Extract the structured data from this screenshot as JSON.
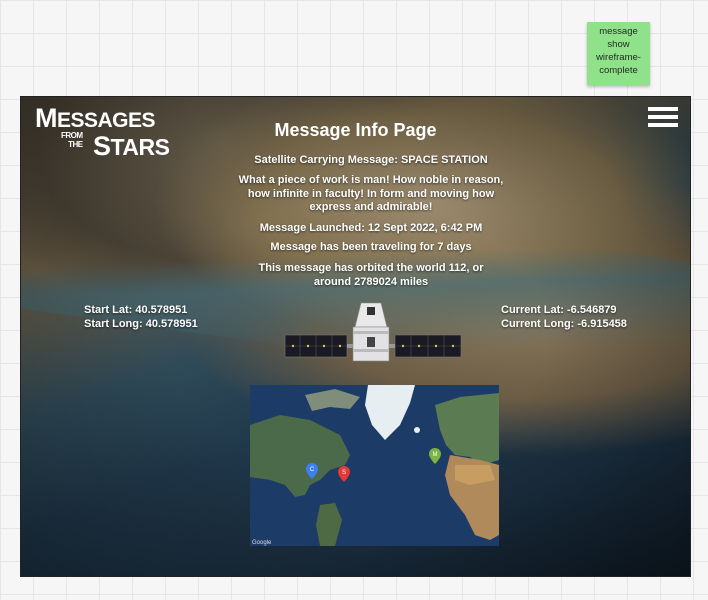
{
  "sticky_note": {
    "text": "message show wireframe-complete"
  },
  "logo": {
    "m": "M",
    "essages": "ESSAGES",
    "from_the": "FROM\nTHE",
    "s": "S",
    "tars": "TARS"
  },
  "page": {
    "title": "Message Info Page",
    "satellite_line": "Satellite Carrying Message: SPACE STATION",
    "quote": "What a piece of work is man! How noble in reason, how infinite in faculty! In form and moving how express and admirable!",
    "launched": "Message Launched: 12  Sept 2022, 6:42 PM",
    "traveling": "Message has been traveling for  7 days",
    "orbited": "This message has orbited the world 112, or around 2789024 miles"
  },
  "coordinates": {
    "start_lat": "Start Lat: 40.578951",
    "start_long": "Start Long: 40.578951",
    "current_lat": "Current Lat: -6.546879",
    "current_long": "Current Long: -6.915458"
  },
  "map": {
    "footer_brand": "Google",
    "pins": [
      {
        "label": "C",
        "color": "#3b7ff5"
      },
      {
        "label": "S",
        "color": "#e53935"
      },
      {
        "label": "M",
        "color": "#7cb342"
      }
    ]
  },
  "icons": {
    "menu": "hamburger-menu-icon",
    "satellite": "satellite-image",
    "map": "world-map-image"
  },
  "colors": {
    "sticky": "#8fe18a",
    "text": "#ffffff"
  }
}
